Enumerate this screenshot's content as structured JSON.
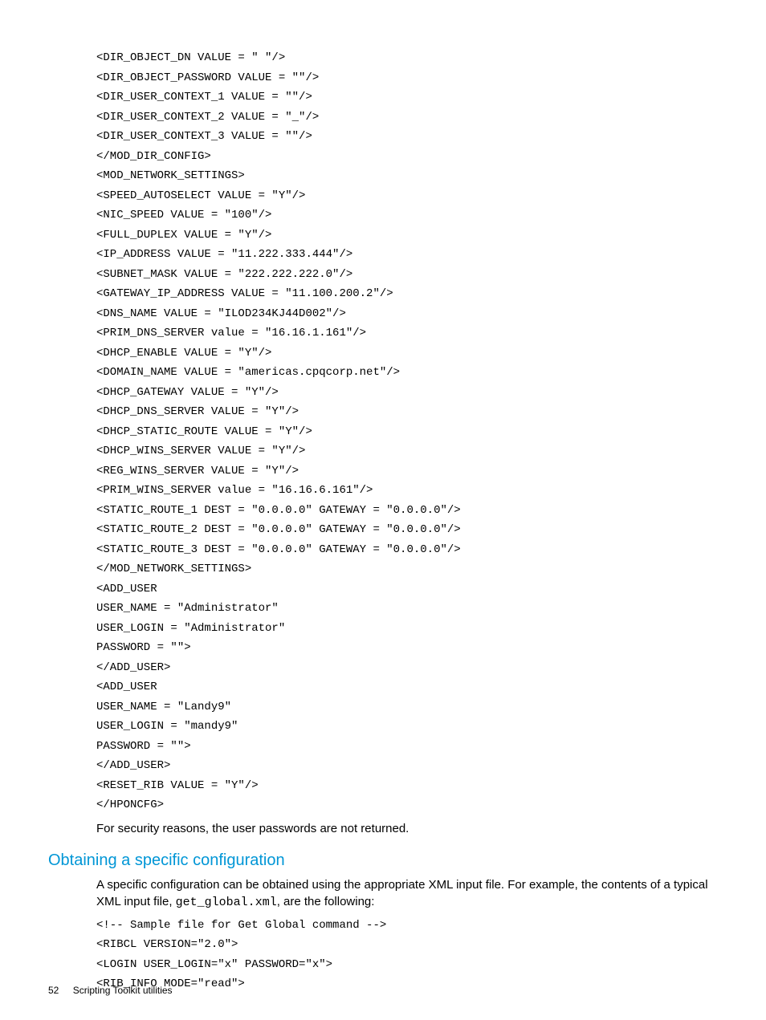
{
  "code1": "<DIR_OBJECT_DN VALUE = \" \"/>\n<DIR_OBJECT_PASSWORD VALUE = \"\"/>\n<DIR_USER_CONTEXT_1 VALUE = \"\"/>\n<DIR_USER_CONTEXT_2 VALUE = \"_\"/>\n<DIR_USER_CONTEXT_3 VALUE = \"\"/>\n</MOD_DIR_CONFIG>\n<MOD_NETWORK_SETTINGS>\n<SPEED_AUTOSELECT VALUE = \"Y\"/>\n<NIC_SPEED VALUE = \"100\"/>\n<FULL_DUPLEX VALUE = \"Y\"/>\n<IP_ADDRESS VALUE = \"11.222.333.444\"/>\n<SUBNET_MASK VALUE = \"222.222.222.0\"/>\n<GATEWAY_IP_ADDRESS VALUE = \"11.100.200.2\"/>\n<DNS_NAME VALUE = \"ILOD234KJ44D002\"/>\n<PRIM_DNS_SERVER value = \"16.16.1.161\"/>\n<DHCP_ENABLE VALUE = \"Y\"/>\n<DOMAIN_NAME VALUE = \"americas.cpqcorp.net\"/>\n<DHCP_GATEWAY VALUE = \"Y\"/>\n<DHCP_DNS_SERVER VALUE = \"Y\"/>\n<DHCP_STATIC_ROUTE VALUE = \"Y\"/>\n<DHCP_WINS_SERVER VALUE = \"Y\"/>\n<REG_WINS_SERVER VALUE = \"Y\"/>\n<PRIM_WINS_SERVER value = \"16.16.6.161\"/>\n<STATIC_ROUTE_1 DEST = \"0.0.0.0\" GATEWAY = \"0.0.0.0\"/>\n<STATIC_ROUTE_2 DEST = \"0.0.0.0\" GATEWAY = \"0.0.0.0\"/>\n<STATIC_ROUTE_3 DEST = \"0.0.0.0\" GATEWAY = \"0.0.0.0\"/>\n</MOD_NETWORK_SETTINGS>\n<ADD_USER\nUSER_NAME = \"Administrator\"\nUSER_LOGIN = \"Administrator\"\nPASSWORD = \"\">\n</ADD_USER>\n<ADD_USER\nUSER_NAME = \"Landy9\"\nUSER_LOGIN = \"mandy9\"\nPASSWORD = \"\">\n</ADD_USER>\n<RESET_RIB VALUE = \"Y\"/>\n</HPONCFG>",
  "body1": "For security reasons, the user passwords are not returned.",
  "heading": "Obtaining a specific configuration",
  "body2_pre": "A specific configuration can be obtained using the appropriate XML input file. For example, the contents of a typical XML input file, ",
  "body2_code": "get_global.xml",
  "body2_post": ", are the following:",
  "code2": "<!-- Sample file for Get Global command -->\n<RIBCL VERSION=\"2.0\">\n<LOGIN USER_LOGIN=\"x\" PASSWORD=\"x\">\n<RIB_INFO MODE=\"read\">",
  "footer": {
    "page": "52",
    "title": "Scripting Toolkit utilities"
  }
}
